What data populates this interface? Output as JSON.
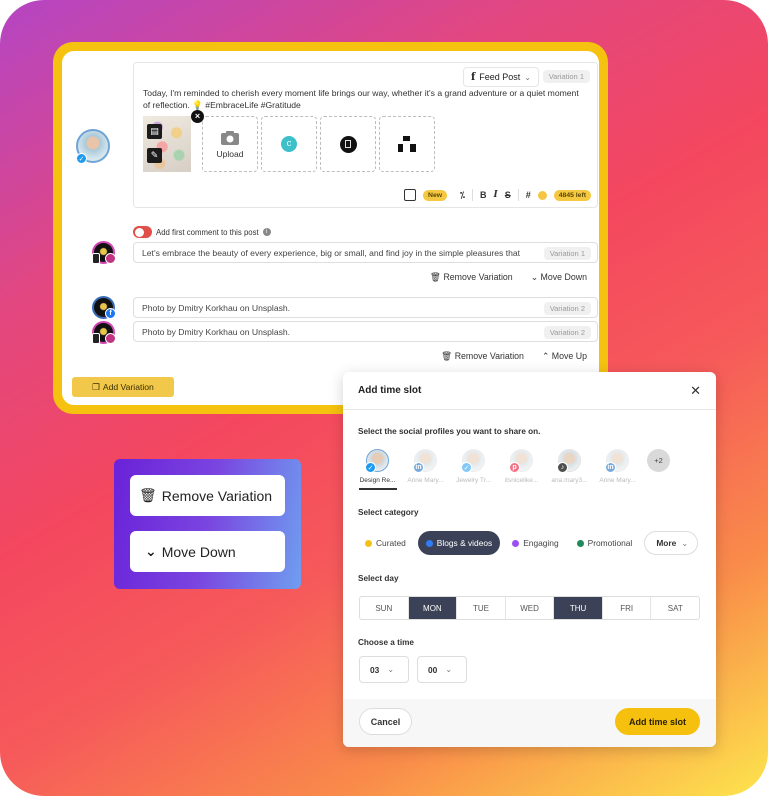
{
  "composer": {
    "post_type": "Feed Post",
    "variation_label": "Variation 1",
    "post_text": "Today, I'm reminded to cherish every moment life brings our way, whether it's a grand adventure or a quiet moment of reflection. 💡 #EmbraceLife #Gratitude",
    "media": {
      "upload_label": "Upload",
      "sources": [
        "canva-icon",
        "google-drive-icon",
        "unsplash-icon"
      ]
    },
    "toolbar": {
      "new_badge": "New",
      "bold": "B",
      "italic": "I",
      "strike": "S",
      "hashtag": "#",
      "chars_left": "4845 left"
    },
    "first_comment_label": "Add first comment to this post",
    "variations": [
      {
        "text": "Let's embrace the beauty of every experience, big or small, and find joy in the simple pleasures that",
        "tag": "Variation 1"
      },
      {
        "text": "Photo by Dmitry Korkhau on Unsplash.",
        "tag": "Variation 2"
      },
      {
        "text": "Photo by Dmitry Korkhau on Unsplash.",
        "tag": "Variation 2"
      }
    ],
    "actions_1": {
      "remove": "Remove Variation",
      "move": "Move Down"
    },
    "actions_2": {
      "remove": "Remove Variation",
      "move": "Move Up"
    },
    "add_variation": "Add Variation"
  },
  "callout": {
    "remove": "Remove Variation",
    "move_down": "Move Down"
  },
  "modal": {
    "title": "Add time slot",
    "profiles_label": "Select the social profiles you want to share on.",
    "profiles": [
      {
        "name": "Design Re...",
        "network": "twitter",
        "active": true
      },
      {
        "name": "Anne Mary...",
        "network": "linkedin",
        "active": false
      },
      {
        "name": "Jewelry Tr...",
        "network": "twitter",
        "active": false
      },
      {
        "name": "itsnicelike...",
        "network": "pinterest",
        "active": false
      },
      {
        "name": "ana.mary3...",
        "network": "tiktok",
        "active": false
      },
      {
        "name": "Anne Mary...",
        "network": "linkedin",
        "active": false
      }
    ],
    "more_profiles": "+2",
    "category_label": "Select category",
    "categories": [
      {
        "label": "Curated",
        "color": "#f2c21b",
        "selected": false
      },
      {
        "label": "Blogs & videos",
        "color": "#2f7df6",
        "selected": true
      },
      {
        "label": "Engaging",
        "color": "#9b4ff0",
        "selected": false
      },
      {
        "label": "Promotional",
        "color": "#1f8a5b",
        "selected": false
      }
    ],
    "more_label": "More",
    "day_label": "Select day",
    "days": [
      {
        "label": "SUN",
        "selected": false
      },
      {
        "label": "MON",
        "selected": true
      },
      {
        "label": "TUE",
        "selected": false
      },
      {
        "label": "WED",
        "selected": false
      },
      {
        "label": "THU",
        "selected": true
      },
      {
        "label": "FRI",
        "selected": false
      },
      {
        "label": "SAT",
        "selected": false
      }
    ],
    "time_label": "Choose a time",
    "hour": "03",
    "minute": "00",
    "cancel": "Cancel",
    "submit": "Add time slot"
  }
}
